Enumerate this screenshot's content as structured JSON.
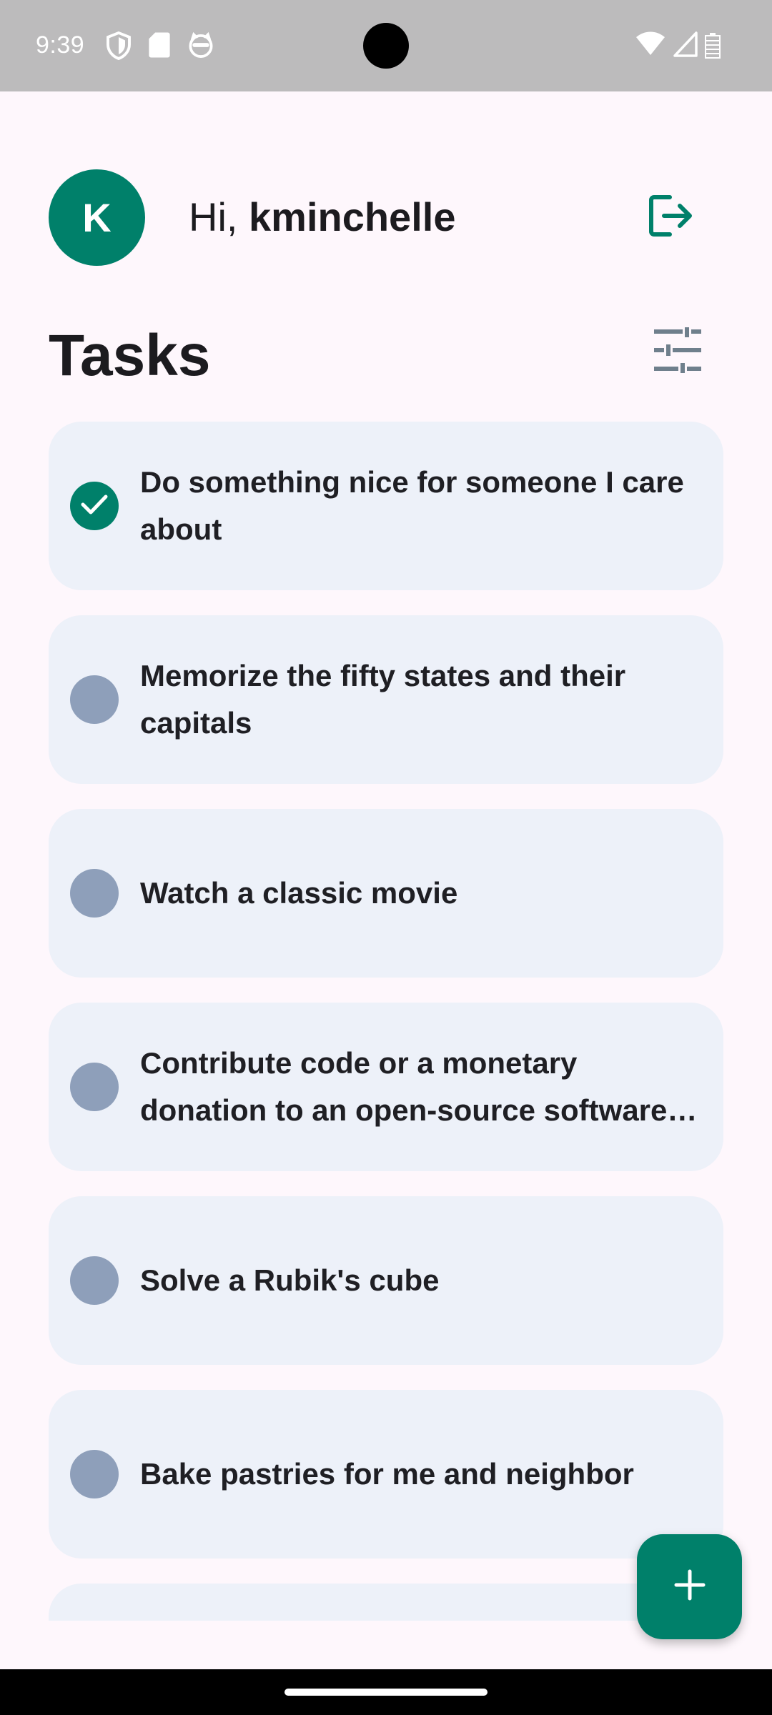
{
  "status_bar": {
    "time": "9:39",
    "left_icons": [
      "shield-icon",
      "sd-card-icon",
      "cat-face-icon"
    ],
    "right_icons": [
      "wifi-icon",
      "signal-icon",
      "battery-icon"
    ]
  },
  "header": {
    "avatar_letter": "K",
    "greeting_prefix": "Hi, ",
    "username": "kminchelle",
    "logout_icon": "logout-icon"
  },
  "section": {
    "title": "Tasks",
    "filter_icon": "tune-icon"
  },
  "tasks": [
    {
      "text": "Do something nice for someone I care about",
      "completed": true
    },
    {
      "text": "Memorize the fifty states and their capitals",
      "completed": false
    },
    {
      "text": "Watch a classic movie",
      "completed": false
    },
    {
      "text": "Contribute code or a monetary donation to an open-source software project",
      "completed": false
    },
    {
      "text": "Solve a Rubik's cube",
      "completed": false
    },
    {
      "text": "Bake pastries for me and neighbor",
      "completed": false
    },
    {
      "text": "",
      "completed": false
    }
  ],
  "fab": {
    "icon": "plus-icon"
  },
  "colors": {
    "accent": "#00806a",
    "card_background": "#edf1f9",
    "unchecked": "#8e9fba",
    "page_background": "#fef7fc"
  }
}
